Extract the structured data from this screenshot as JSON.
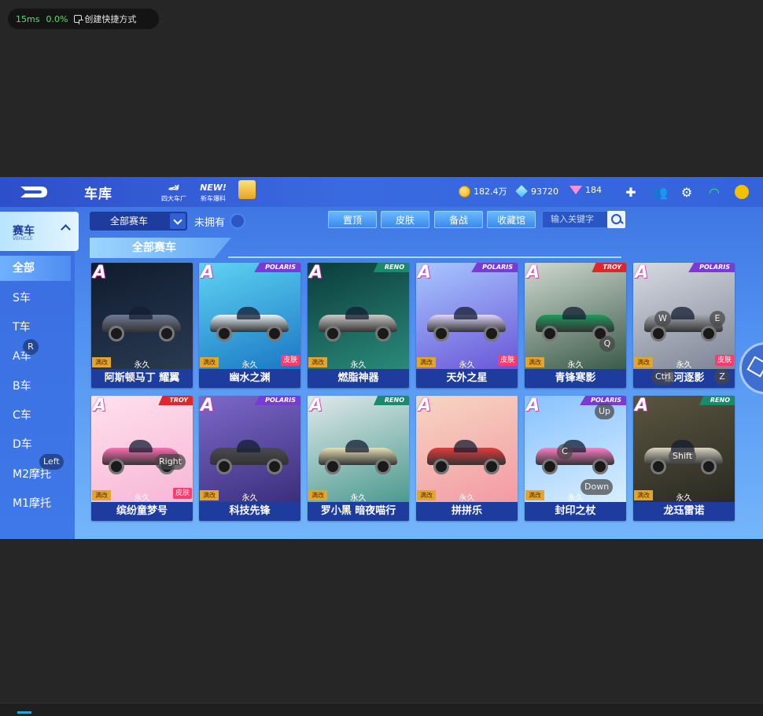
{
  "overlay": {
    "latency": "15ms",
    "loss": "0.0%",
    "shortcut_label": "创建快捷方式"
  },
  "topbar": {
    "title": "车库",
    "icons": [
      {
        "label": "四大车厂",
        "icon": "factory-icon"
      },
      {
        "label": "新车爆料",
        "icon": "new-car-icon",
        "badge": "NEW!"
      },
      {
        "label": "",
        "icon": "gift-box-icon"
      }
    ],
    "currencies": [
      {
        "icon": "coin-icon",
        "value": "182.4万"
      },
      {
        "icon": "ticket-icon",
        "value": "93720"
      },
      {
        "icon": "diamond-icon",
        "value": "184"
      }
    ],
    "right_icons": [
      "add-icon",
      "friends-icon",
      "settings-icon",
      "wifi-icon",
      "avatar-icon"
    ]
  },
  "sidebar": {
    "main": {
      "label": "赛车",
      "sub": "VEHICLE"
    },
    "items": [
      {
        "label": "全部",
        "active": true
      },
      {
        "label": "S车"
      },
      {
        "label": "T车"
      },
      {
        "label": "A车"
      },
      {
        "label": "B车"
      },
      {
        "label": "C车"
      },
      {
        "label": "D车"
      },
      {
        "label": "M2摩托"
      },
      {
        "label": "M1摩托"
      }
    ]
  },
  "filters": {
    "select_value": "全部赛车",
    "not_owned_label": "未拥有",
    "buttons": [
      "置顶",
      "皮肤",
      "备战",
      "收藏馆"
    ],
    "search_placeholder": "输入关键字"
  },
  "section_title": "全部赛车",
  "cards": [
    {
      "name": "阿斯顿马丁 耀翼",
      "grade": "A",
      "brand": "",
      "max": "满改",
      "duration": "永久",
      "skin": "",
      "bg": [
        "#0f1b2e",
        "#2a3a52"
      ],
      "car": "#6f7b96"
    },
    {
      "name": "幽水之渊",
      "grade": "A",
      "brand": "POLARIS",
      "max": "满改",
      "duration": "永久",
      "skin": "皮肤",
      "bg": [
        "#5fd3f2",
        "#1a78c4"
      ],
      "car": "#e8f6ff"
    },
    {
      "name": "燃脂神器",
      "grade": "A",
      "brand": "RENO",
      "max": "满改",
      "duration": "永久",
      "skin": "",
      "bg": [
        "#0b3b3b",
        "#2a8a7a"
      ],
      "car": "#c9cbc7"
    },
    {
      "name": "天外之星",
      "grade": "A",
      "brand": "POLARIS",
      "max": "满改",
      "duration": "永久",
      "skin": "皮肤",
      "bg": [
        "#a8c8ff",
        "#6a56d8"
      ],
      "car": "#e0d8ff"
    },
    {
      "name": "青锋寒影",
      "grade": "A",
      "brand": "TROY",
      "max": "满改",
      "duration": "永久",
      "skin": "",
      "bg": [
        "#cfd8cf",
        "#3b5b49"
      ],
      "car": "#1f9a5a"
    },
    {
      "name": "银河逐影",
      "grade": "A",
      "brand": "POLARIS",
      "max": "满改",
      "duration": "永久",
      "skin": "皮肤",
      "bg": [
        "#d6dae2",
        "#7d8494"
      ],
      "car": "#a4a9b3"
    },
    {
      "name": "缤纷童梦号",
      "grade": "A",
      "brand": "TROY",
      "max": "满改",
      "duration": "永久",
      "skin": "皮肤",
      "bg": [
        "#ffe1ec",
        "#f7b6d6"
      ],
      "car": "#ff6fb5"
    },
    {
      "name": "科技先锋",
      "grade": "A",
      "brand": "POLARIS",
      "max": "满改",
      "duration": "永久",
      "skin": "",
      "bg": [
        "#7d68c9",
        "#3a2f7c"
      ],
      "car": "#4a4a52"
    },
    {
      "name": "罗小黑 暗夜喵行",
      "grade": "A",
      "brand": "RENO",
      "max": "满改",
      "duration": "永久",
      "skin": "",
      "bg": [
        "#e0e9ea",
        "#4c9a8f"
      ],
      "car": "#e8e1b6"
    },
    {
      "name": "拼拼乐",
      "grade": "A",
      "brand": "",
      "max": "满改",
      "duration": "永久",
      "skin": "",
      "bg": [
        "#f6d6c2",
        "#f39aa3"
      ],
      "car": "#e43a3a"
    },
    {
      "name": "封印之杖",
      "grade": "A",
      "brand": "POLARIS",
      "max": "满改",
      "duration": "永久",
      "skin": "",
      "bg": [
        "#87c2ff",
        "#d8eeff"
      ],
      "car": "#ff7fc7"
    },
    {
      "name": "龙珏雷诺",
      "grade": "A",
      "brand": "RENO",
      "max": "满改",
      "duration": "永久",
      "skin": "",
      "bg": [
        "#5a5540",
        "#2a2a22"
      ],
      "car": "#d9d5c2"
    }
  ],
  "key_hints": [
    "R",
    "Left",
    "Right",
    "W",
    "E",
    "Q",
    "Ctrl",
    "Z",
    "Up",
    "C",
    "Shift",
    "Down"
  ]
}
